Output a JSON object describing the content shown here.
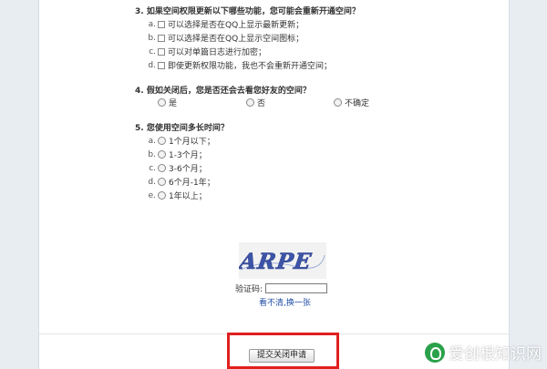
{
  "survey": {
    "q3": {
      "title": "3. 如果空间权限更新以下哪些功能，您可能会重新开通空间？",
      "options": [
        {
          "letter": "a.",
          "label": "可以选择是否在QQ上显示最新更新；"
        },
        {
          "letter": "b.",
          "label": "可以选择是否在QQ上显示空间图标；"
        },
        {
          "letter": "c.",
          "label": "可以对单篇日志进行加密；"
        },
        {
          "letter": "d.",
          "label": "即使更新权限功能，我也不会重新开通空间；"
        }
      ]
    },
    "q4": {
      "title": "4. 假如关闭后，您是否还会去看您好友的空间？",
      "options": [
        {
          "label": "是"
        },
        {
          "label": "否"
        },
        {
          "label": "不确定"
        }
      ]
    },
    "q5": {
      "title": "5. 您使用空间多长时间？",
      "options": [
        {
          "letter": "a.",
          "label": "1个月以下；"
        },
        {
          "letter": "b.",
          "label": "1-3个月；"
        },
        {
          "letter": "c.",
          "label": "3-6个月；"
        },
        {
          "letter": "d.",
          "label": "6个月-1年；"
        },
        {
          "letter": "e.",
          "label": "1年以上；"
        }
      ]
    }
  },
  "captcha": {
    "image_text": "ARPE",
    "label": "验证码:",
    "input_value": "",
    "refresh_link": "看不清,换一张"
  },
  "submit": {
    "label": "提交关闭申请"
  },
  "watermark": {
    "text": "爱创根知识网"
  },
  "colors": {
    "highlight": "#e0201f",
    "link": "#1f4ea6"
  }
}
